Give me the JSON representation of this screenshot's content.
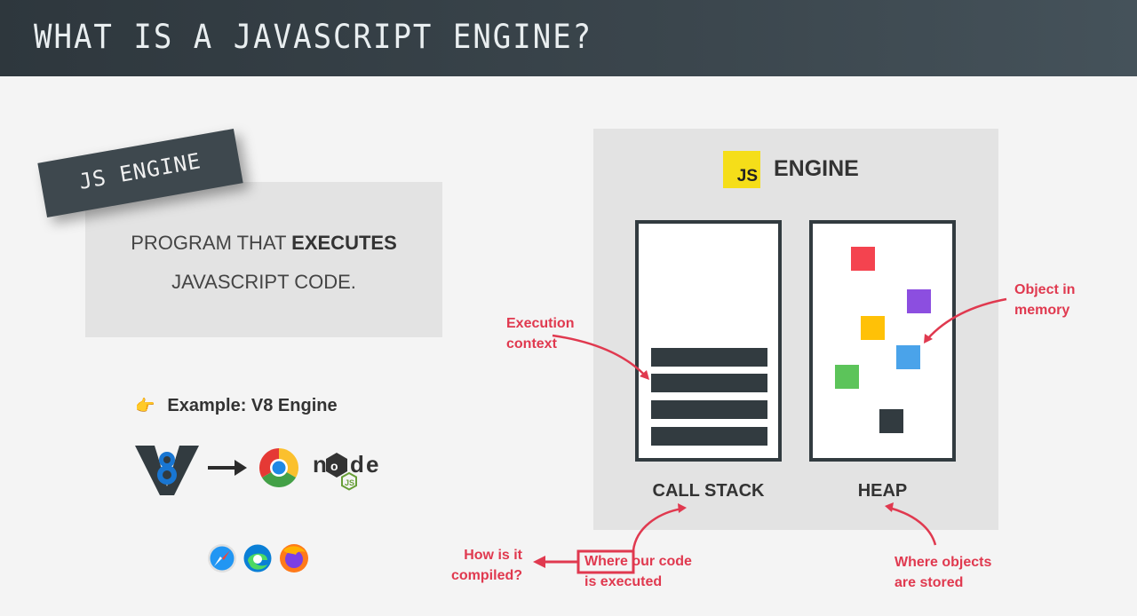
{
  "header": {
    "title": "WHAT IS A JAVASCRIPT ENGINE?"
  },
  "definition": {
    "tag": "JS ENGINE",
    "line1_prefix": "PROGRAM THAT ",
    "line1_bold": "EXECUTES",
    "line2": "JAVASCRIPT CODE."
  },
  "example": {
    "label": "Example: V8 Engine"
  },
  "engine": {
    "badge": "JS",
    "title": "ENGINE",
    "call_stack_label": "CALL STACK",
    "heap_label": "HEAP"
  },
  "annotations": {
    "execution_context": [
      "Execution",
      "context"
    ],
    "object_in_memory": [
      "Object in",
      "memory"
    ],
    "how_compiled": [
      "How is it",
      "compiled?"
    ],
    "where_executed": [
      "Where our code",
      "is executed"
    ],
    "where_stored": [
      "Where objects",
      "are stored"
    ]
  },
  "colors": {
    "accent": "#e0394f",
    "js_yellow": "#f5de19",
    "dark": "#323b40",
    "heap_objects": [
      "#f4434f",
      "#8c4ee0",
      "#ffc107",
      "#4aa3ea",
      "#5cc45a",
      "#323b40"
    ]
  },
  "icons": [
    "v8-logo-icon",
    "arrow-right-icon",
    "chrome-icon",
    "nodejs-logo-icon",
    "safari-icon",
    "edge-icon",
    "firefox-icon",
    "pointing-hand-icon"
  ]
}
